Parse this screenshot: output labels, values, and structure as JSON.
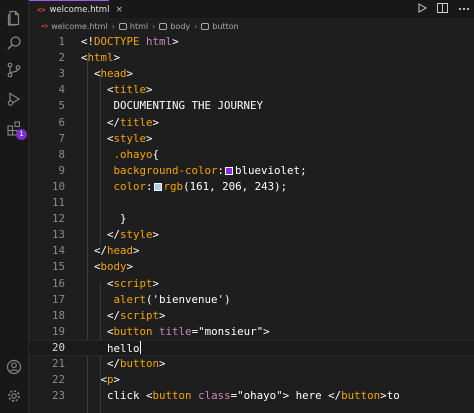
{
  "tab": {
    "file_icon": "<>",
    "label": "welcome.html",
    "close": "×"
  },
  "tab_actions": [
    "run-icon",
    "split-editor-icon",
    "more-icon"
  ],
  "breadcrumb": [
    {
      "label": "welcome.html",
      "icon": "html-file-icon"
    },
    {
      "label": "html",
      "icon": "element-icon"
    },
    {
      "label": "body",
      "icon": "element-icon"
    },
    {
      "label": "button",
      "icon": "element-icon"
    }
  ],
  "activity_bar": {
    "items": [
      "explorer-icon",
      "search-icon",
      "source-control-icon",
      "run-debug-icon",
      "extensions-icon"
    ],
    "extensions_badge": "1",
    "bottom_items": [
      "account-icon",
      "settings-gear-icon"
    ]
  },
  "colors": {
    "blueviolet": "#8a2be2",
    "swatch_rgb": "#a1cef3",
    "tag": "#f4a400",
    "attribute": "#c586c0"
  },
  "editor": {
    "current_line": 20,
    "lines": [
      {
        "n": "1",
        "indent": 0,
        "tokens": [
          [
            "pun",
            "<!"
          ],
          [
            "tag",
            "DOCTYPE"
          ],
          [
            "text",
            " "
          ],
          [
            "attr",
            "html"
          ],
          [
            "pun",
            ">"
          ]
        ]
      },
      {
        "n": "2",
        "indent": 0,
        "tokens": [
          [
            "pun",
            "<"
          ],
          [
            "tag",
            "html"
          ],
          [
            "pun",
            ">"
          ]
        ]
      },
      {
        "n": "3",
        "indent": 1,
        "tokens": [
          [
            "pun",
            "<"
          ],
          [
            "tag",
            "head"
          ],
          [
            "pun",
            ">"
          ]
        ]
      },
      {
        "n": "4",
        "indent": 2,
        "tokens": [
          [
            "pun",
            "<"
          ],
          [
            "tag",
            "title"
          ],
          [
            "pun",
            ">"
          ]
        ]
      },
      {
        "n": "5",
        "indent": 2,
        "tokens": [
          [
            "text",
            " DOCUMENTING THE JOURNEY"
          ]
        ]
      },
      {
        "n": "6",
        "indent": 2,
        "tokens": [
          [
            "pun",
            "</"
          ],
          [
            "tag",
            "title"
          ],
          [
            "pun",
            ">"
          ]
        ]
      },
      {
        "n": "7",
        "indent": 2,
        "tokens": [
          [
            "pun",
            "<"
          ],
          [
            "tag",
            "style"
          ],
          [
            "pun",
            ">"
          ]
        ]
      },
      {
        "n": "8",
        "indent": 2,
        "tokens": [
          [
            "text",
            " "
          ],
          [
            "sel",
            ".ohayo"
          ],
          [
            "pun",
            "{"
          ]
        ]
      },
      {
        "n": "9",
        "indent": 2,
        "tokens": [
          [
            "text",
            " "
          ],
          [
            "prop",
            "background-color"
          ],
          [
            "pun",
            ":"
          ],
          [
            "swatch",
            "blueviolet"
          ],
          [
            "text",
            "blueviolet"
          ],
          [
            "pun",
            ";"
          ]
        ]
      },
      {
        "n": "10",
        "indent": 2,
        "tokens": [
          [
            "text",
            " "
          ],
          [
            "prop",
            "color"
          ],
          [
            "pun",
            ":"
          ],
          [
            "swatch",
            "swatch_rgb"
          ],
          [
            "func",
            "rgb"
          ],
          [
            "pun",
            "("
          ],
          [
            "num",
            "161"
          ],
          [
            "pun",
            ", "
          ],
          [
            "num",
            "206"
          ],
          [
            "pun",
            ", "
          ],
          [
            "num",
            "243"
          ],
          [
            "pun",
            ");"
          ]
        ]
      },
      {
        "n": "11",
        "indent": 2,
        "tokens": []
      },
      {
        "n": "12",
        "indent": 2,
        "tokens": [
          [
            "text",
            "  "
          ],
          [
            "pun",
            "}"
          ]
        ]
      },
      {
        "n": "13",
        "indent": 2,
        "tokens": [
          [
            "pun",
            "</"
          ],
          [
            "tag",
            "style"
          ],
          [
            "pun",
            ">"
          ]
        ]
      },
      {
        "n": "14",
        "indent": 1,
        "tokens": [
          [
            "pun",
            "</"
          ],
          [
            "tag",
            "head"
          ],
          [
            "pun",
            ">"
          ]
        ]
      },
      {
        "n": "15",
        "indent": 1,
        "tokens": [
          [
            "pun",
            "<"
          ],
          [
            "tag",
            "body"
          ],
          [
            "pun",
            ">"
          ]
        ]
      },
      {
        "n": "16",
        "indent": 2,
        "tokens": [
          [
            "pun",
            "<"
          ],
          [
            "tag",
            "script"
          ],
          [
            "pun",
            ">"
          ]
        ]
      },
      {
        "n": "17",
        "indent": 2,
        "tokens": [
          [
            "text",
            " "
          ],
          [
            "func",
            "alert"
          ],
          [
            "pun",
            "("
          ],
          [
            "str",
            "'bienvenue'"
          ],
          [
            "pun",
            ")"
          ]
        ]
      },
      {
        "n": "18",
        "indent": 2,
        "tokens": [
          [
            "pun",
            "</"
          ],
          [
            "tag",
            "script"
          ],
          [
            "pun",
            ">"
          ]
        ]
      },
      {
        "n": "19",
        "indent": 2,
        "tokens": [
          [
            "pun",
            "<"
          ],
          [
            "tag",
            "button"
          ],
          [
            "text",
            " "
          ],
          [
            "attr",
            "title"
          ],
          [
            "pun",
            "="
          ],
          [
            "str",
            "\"monsieur\""
          ],
          [
            "pun",
            ">"
          ]
        ]
      },
      {
        "n": "20",
        "indent": 2,
        "tokens": [
          [
            "text",
            "hello"
          ],
          [
            "cursor",
            ""
          ]
        ]
      },
      {
        "n": "21",
        "indent": 2,
        "tokens": [
          [
            "pun",
            "</"
          ],
          [
            "tag",
            "button"
          ],
          [
            "pun",
            ">"
          ]
        ]
      },
      {
        "n": "22",
        "indent": 1,
        "tokens": [
          [
            "text",
            " "
          ],
          [
            "pun",
            "<"
          ],
          [
            "tag",
            "p"
          ],
          [
            "pun",
            ">"
          ]
        ]
      },
      {
        "n": "23",
        "indent": 2,
        "tokens": [
          [
            "text",
            "click "
          ],
          [
            "pun",
            "<"
          ],
          [
            "tag",
            "button"
          ],
          [
            "text",
            " "
          ],
          [
            "attr",
            "class"
          ],
          [
            "pun",
            "="
          ],
          [
            "str",
            "\"ohayo\""
          ],
          [
            "pun",
            ">"
          ],
          [
            "text",
            " here "
          ],
          [
            "pun",
            "</"
          ],
          [
            "tag",
            "button"
          ],
          [
            "pun",
            ">"
          ],
          [
            "text",
            "to"
          ]
        ]
      }
    ]
  }
}
